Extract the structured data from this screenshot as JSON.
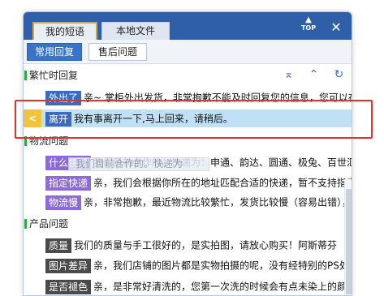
{
  "header": {
    "tabs": [
      {
        "label": "我的短语"
      },
      {
        "label": "本地文件"
      }
    ],
    "top_button_label": "TOP",
    "close_label": "✕"
  },
  "subtabs": [
    {
      "label": "常用回复"
    },
    {
      "label": "售后问题"
    }
  ],
  "groups": [
    {
      "title": "繁忙时回复",
      "rows": [
        {
          "key": "外出了",
          "text": "亲~ 掌柜外出发货，非常抱歉不能及时回复您的信息，您可以在"
        },
        {
          "key": "离开",
          "text": "我有事离开一下,马上回来，请稍后。"
        }
      ]
    },
    {
      "title": "物流问题",
      "rows": [
        {
          "key": "什么快递",
          "text": "我们目前合作的。快递为：申通、韵达、圆通、极兔、百世汇"
        },
        {
          "key": "指定快递",
          "text": "亲，我们会根据你所在的地址匹配合适的快递，暂不支持指定"
        },
        {
          "key": "物流慢",
          "text": "亲，非常抱歉，最近物流比较繁忙，发货比较慢（容易出错），"
        }
      ]
    },
    {
      "title": "产品问题",
      "rows": [
        {
          "key": "质量",
          "text": "我们的质量与手工很好的，是实拍图，请放心购买！阿斯蒂芬"
        },
        {
          "key": "图片差异",
          "text": "亲，我们店铺的图片都是实物拍摄的呢，没有经特别的PS处理"
        },
        {
          "key": "是否褪色",
          "text": "亲，是非常好清洗的，您第一次洗的时候会有点未染上的颜色"
        }
      ]
    }
  ],
  "selected_left_mark": "<",
  "drag_ghost": "我们目前合作的。快递为",
  "toolbar": {
    "up_first": "⌅",
    "up": "⌃",
    "refresh": "↻"
  },
  "colors": {
    "header": "#2f5fa8",
    "key_blue": "#3a6bbf",
    "key_gray": "#4a4a4a",
    "key_purple": "#8c6bd8",
    "selected_row": "#bfe0f5",
    "highlight": "#e53226",
    "group_bar": "#2faa36"
  }
}
